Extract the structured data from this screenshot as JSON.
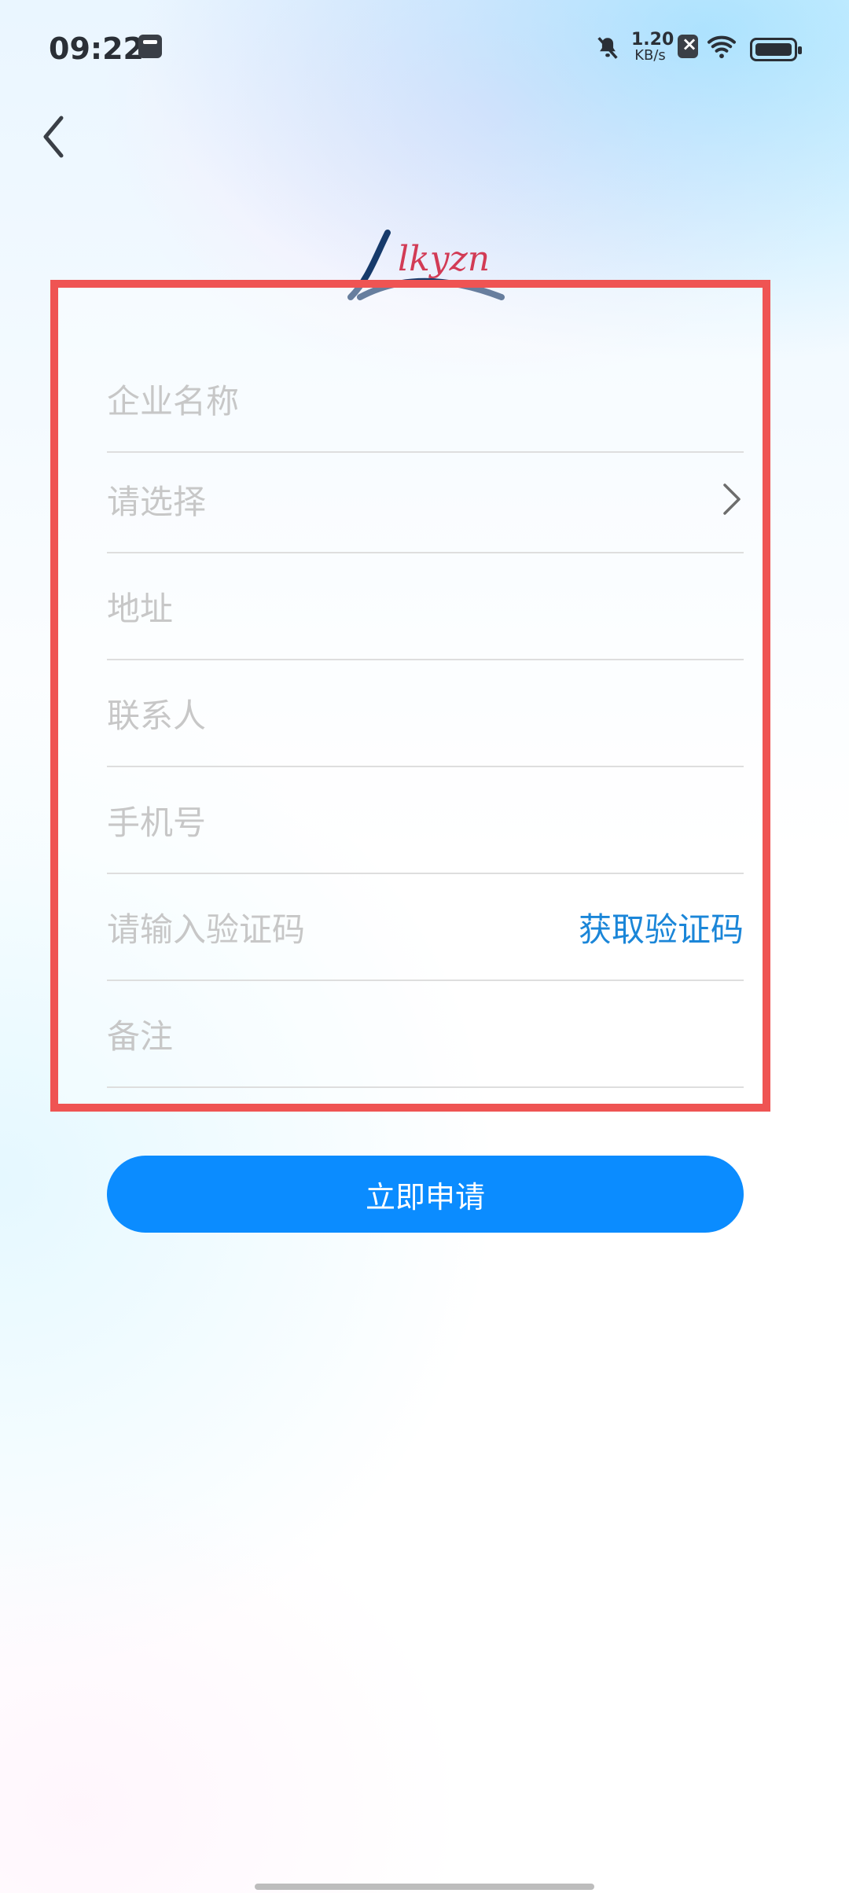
{
  "status_bar": {
    "time": "09:22",
    "net_speed_value": "1.20",
    "net_speed_unit": "KB/s"
  },
  "logo": {
    "text": "lkyzn"
  },
  "form": {
    "fields": [
      {
        "placeholder": "企业名称"
      },
      {
        "placeholder": "请选择"
      },
      {
        "placeholder": "地址"
      },
      {
        "placeholder": "联系人"
      },
      {
        "placeholder": "手机号"
      },
      {
        "placeholder": "请输入验证码",
        "action": "获取验证码"
      },
      {
        "placeholder": "备注"
      }
    ]
  },
  "submit_label": "立即申请",
  "colors": {
    "accent": "#0b8cff",
    "link": "#1b86d8",
    "highlight": "#ef5453",
    "placeholder": "#c7c7c7"
  },
  "icons": {
    "back": "back-chevron-icon",
    "select": "chevron-right-icon",
    "mute": "bell-off-icon",
    "wifi": "wifi-icon",
    "battery": "battery-icon",
    "card": "card-icon",
    "close": "close-box-icon"
  }
}
